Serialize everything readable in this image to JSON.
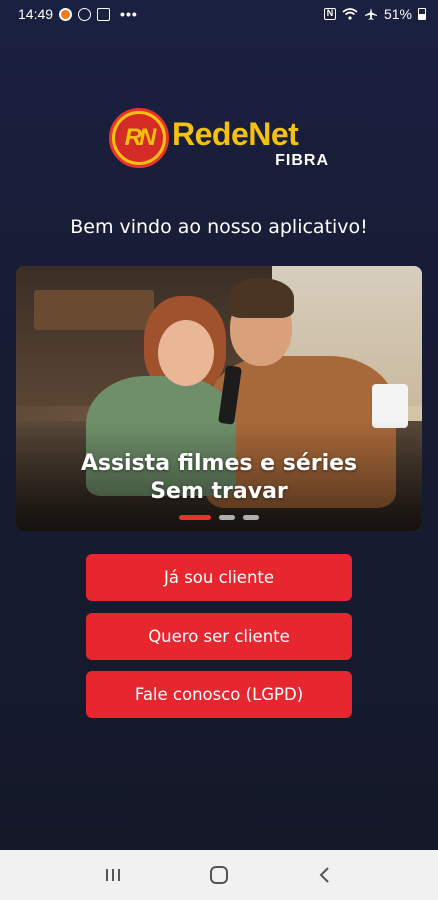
{
  "status_bar": {
    "time": "14:49",
    "overflow": "•••",
    "nfc": "N",
    "battery": "51%",
    "icons": [
      "notification-icon",
      "whatsapp-icon",
      "image-icon",
      "nfc-icon",
      "wifi-icon",
      "airplane-icon",
      "battery-icon"
    ]
  },
  "logo": {
    "badge": "RN",
    "name": "RedeNet",
    "sub": "FIBRA"
  },
  "welcome": "Bem vindo ao nosso aplicativo!",
  "banner": {
    "caption_line1": "Assista filmes e séries",
    "caption_line2": "Sem travar",
    "slides": 3,
    "active_slide": 1
  },
  "buttons": {
    "existing_client": "Já sou cliente",
    "become_client": "Quero ser cliente",
    "contact": "Fale conosco (LGPD)"
  },
  "colors": {
    "background": "#1a2040",
    "accent_red": "#e8262f",
    "logo_yellow": "#f5c10e"
  },
  "nav_bar": {
    "icons": [
      "recent-apps-icon",
      "home-icon",
      "back-icon"
    ]
  }
}
